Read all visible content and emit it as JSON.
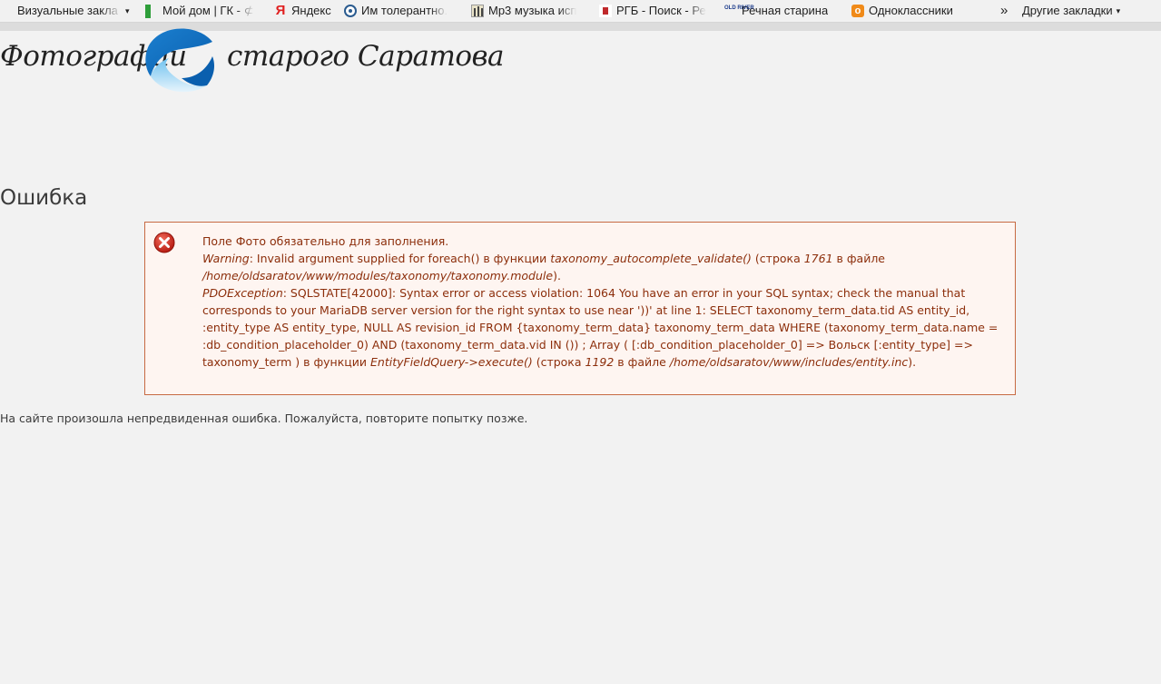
{
  "bookmarks": {
    "items": [
      {
        "label": "Визуальные закла",
        "icon": "folder-icon",
        "caret": "▾"
      },
      {
        "label": "Мой дом | ГК - ⊄",
        "icon": "green-squares-icon"
      },
      {
        "label": "Яндекс",
        "icon": "yandex-icon"
      },
      {
        "label": "Им толерантно.",
        "icon": "globe-icon"
      },
      {
        "label": "Mp3 музыка исп",
        "icon": "mp3-icon"
      },
      {
        "label": "РГБ - Поиск - Ре",
        "icon": "rgb-icon"
      },
      {
        "label": "Речная старина",
        "icon": "old-river-icon",
        "icon_text": "OLD RIVER"
      },
      {
        "label": "Одноклассники",
        "icon": "odnoklassniki-icon"
      }
    ],
    "overflow_chevron": "»",
    "other_label": "Другие закладки",
    "other_caret": "▾"
  },
  "logo": {
    "text_left": "Фотографии",
    "text_right": "старого Саратова"
  },
  "page": {
    "title": "Ошибка",
    "footer": "На сайте произошла непредвиденная ошибка. Пожалуйста, повторите попытку позже."
  },
  "error": {
    "line1": "Поле Фото обязательно для заполнения.",
    "warning_label": "Warning",
    "warning_text": ": Invalid argument supplied for foreach() в функции ",
    "warning_func": "taxonomy_autocomplete_validate()",
    "warning_line_pre": " (строка ",
    "warning_line": "1761",
    "warning_file_pre": " в файле ",
    "warning_file": "/home/oldsaratov/www/modules/taxonomy/taxonomy.module",
    "warning_end": ").",
    "pdo_label": "PDOException",
    "pdo_text": ": SQLSTATE[42000]: Syntax error or access violation: 1064 You have an error in your SQL syntax; check the manual that corresponds to your MariaDB server version for the right syntax to use near '))' at line 1: SELECT taxonomy_term_data.tid AS entity_id, :entity_type AS entity_type, NULL AS revision_id FROM {taxonomy_term_data} taxonomy_term_data WHERE (taxonomy_term_data.name = :db_condition_placeholder_0) AND (taxonomy_term_data.vid IN ()) ; Array ( [:db_condition_placeholder_0] => Вольск [:entity_type] => taxonomy_term ) в функции ",
    "pdo_func": "EntityFieldQuery->execute()",
    "pdo_line_pre": " (строка ",
    "pdo_line": "1192",
    "pdo_file_pre": " в файле ",
    "pdo_file": "/home/oldsaratov/www/includes/entity.inc",
    "pdo_end": ")."
  }
}
